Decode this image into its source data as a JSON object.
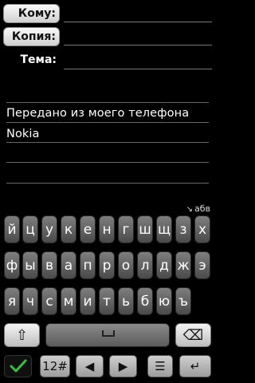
{
  "header": {
    "to_label": "Кому:",
    "cc_label": "Копия:",
    "subject_label": "Тема:"
  },
  "message": {
    "line1": "Передано из моего телефона",
    "line2": "Nokia"
  },
  "keyboard": {
    "input_mode": "абв",
    "row1": [
      "й",
      "ц",
      "у",
      "к",
      "е",
      "н",
      "г",
      "ш",
      "щ",
      "з",
      "х"
    ],
    "row2": [
      "ф",
      "ы",
      "в",
      "а",
      "п",
      "р",
      "о",
      "л",
      "д",
      "ж",
      "э"
    ],
    "row3": [
      "я",
      "ч",
      "с",
      "м",
      "и",
      "т",
      "ь",
      "б",
      "ю",
      "ъ"
    ],
    "numeric_label": "12#"
  }
}
